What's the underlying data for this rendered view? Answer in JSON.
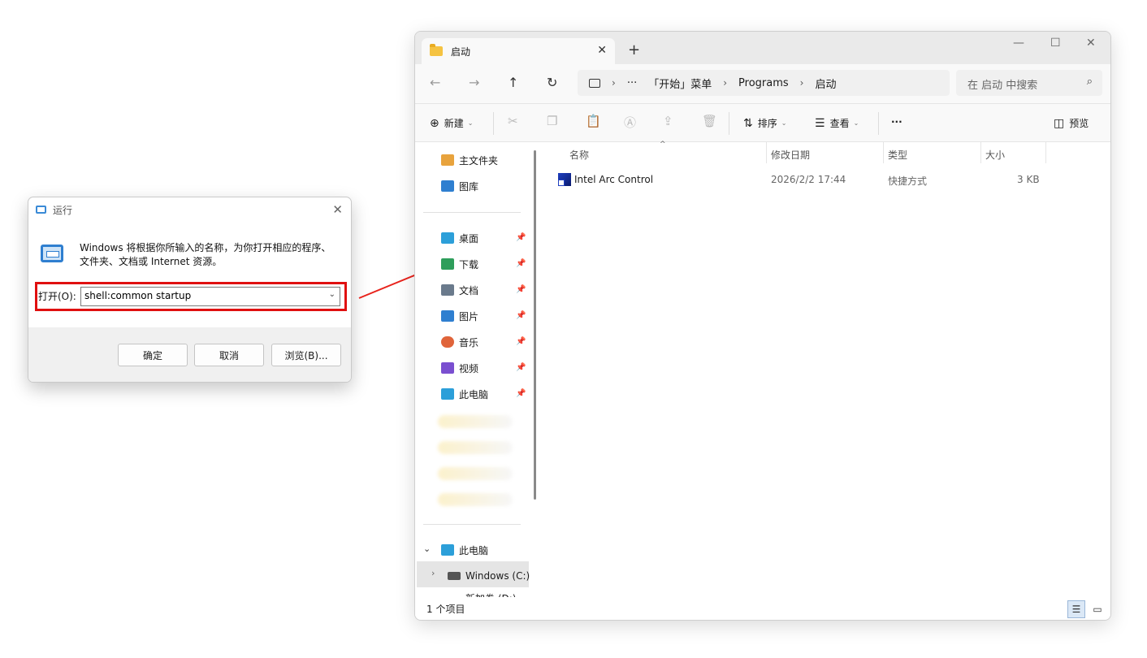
{
  "run_dialog": {
    "title": "运行",
    "description": "Windows 将根据你所输入的名称，为你打开相应的程序、文件夹、文档或 Internet 资源。",
    "open_label": "打开(O):",
    "input_value": "shell:common startup",
    "buttons": {
      "ok": "确定",
      "cancel": "取消",
      "browse": "浏览(B)..."
    },
    "icons": {
      "title_icon": "run-icon",
      "big_icon": "run-app-icon",
      "close_icon": "close-icon"
    }
  },
  "explorer": {
    "tab": {
      "title": "启动",
      "close": "✕",
      "new_tab": "+"
    },
    "window_controls": {
      "minimize": "—",
      "maximize": "☐",
      "close": "✕"
    },
    "nav": {
      "back": "←",
      "forward": "→",
      "up": "↑",
      "refresh": "↻"
    },
    "breadcrumb": {
      "ellipsis": "···",
      "items": [
        "「开始」菜单",
        "Programs",
        "启动"
      ],
      "separator": "›"
    },
    "search_placeholder": "在 启动 中搜索",
    "toolbar": {
      "new": "新建",
      "sort": "排序",
      "view": "查看",
      "more": "···",
      "preview": "预览"
    },
    "sidebar": {
      "top": [
        {
          "label": "主文件夹",
          "color": "#e8a33d"
        },
        {
          "label": "图库",
          "color": "#2f7fd0"
        }
      ],
      "quick": [
        {
          "label": "桌面",
          "color": "#2c9fd9"
        },
        {
          "label": "下载",
          "color": "#2e9e5b"
        },
        {
          "label": "文档",
          "color": "#6a7a8c"
        },
        {
          "label": "图片",
          "color": "#2f7fd0"
        },
        {
          "label": "音乐",
          "color": "#e0643a"
        },
        {
          "label": "视频",
          "color": "#7a4fd0"
        },
        {
          "label": "此电脑",
          "color": "#2c9fd9"
        }
      ],
      "this_pc": "此电脑",
      "drive_c": "Windows (C:)",
      "drive_d": "新加卷 (D:)"
    },
    "columns": {
      "name": "名称",
      "modified": "修改日期",
      "type": "类型",
      "size": "大小"
    },
    "files": [
      {
        "name": "Intel Arc Control",
        "modified": "2026/2/2 17:44",
        "type": "快捷方式",
        "size": "3 KB"
      }
    ],
    "status": "1 个项目"
  },
  "annotation": {
    "arrow_color": "#e8231c",
    "box_color": "#e01010"
  }
}
